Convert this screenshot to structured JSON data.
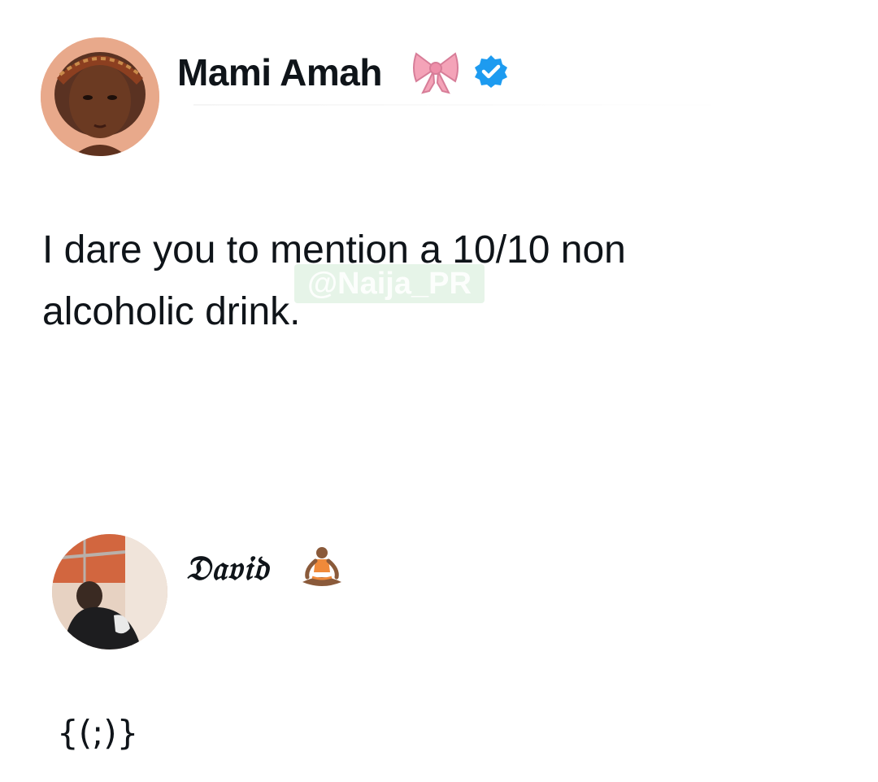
{
  "posts": [
    {
      "author": {
        "display_name": "Mami Amah",
        "name_emoji": "ribbon-bow-icon",
        "verified": true,
        "avatar": "profile-photo"
      },
      "text": "I dare you to mention a 10/10 non alcoholic drink."
    },
    {
      "author": {
        "display_name": "𝔇𝔞𝔳𝔦𝔡",
        "name_emoji": "person-in-lotus-position-icon",
        "avatar": "profile-photo"
      },
      "text": "{(;)}"
    }
  ],
  "watermark": "@Naija_PR",
  "colors": {
    "text": "#0f1419",
    "verified_badge": "#1d9bf0",
    "bow": "#f4a3b8",
    "background": "#ffffff"
  }
}
